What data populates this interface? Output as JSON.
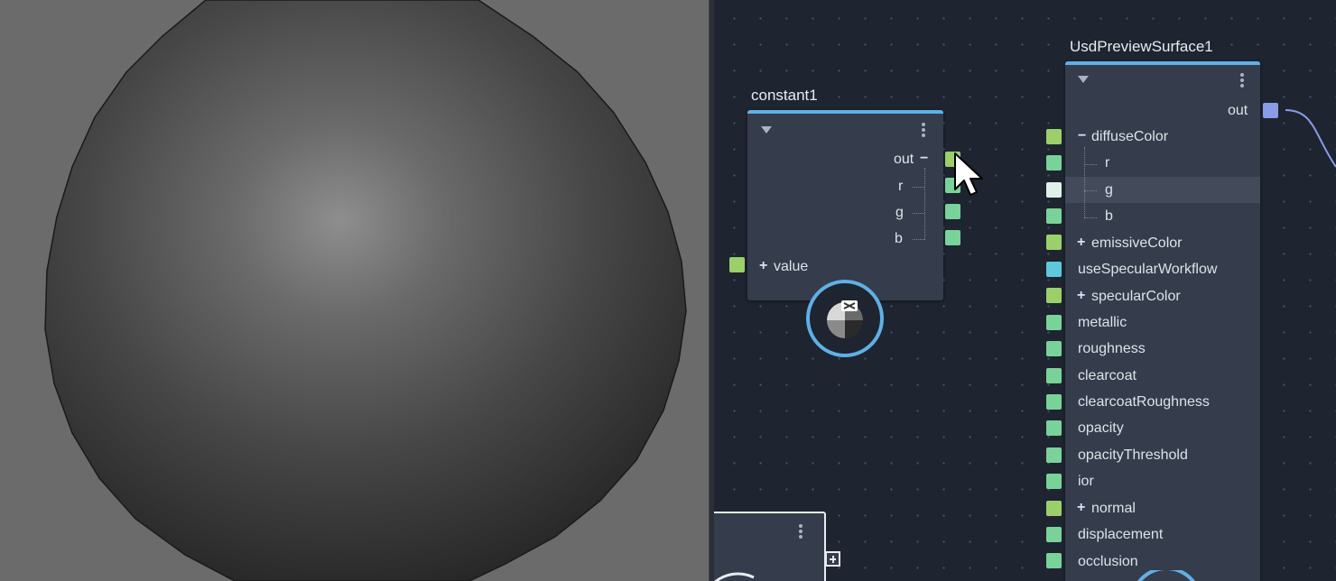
{
  "constant_node": {
    "title": "constant1",
    "outputs": [
      {
        "label": "out",
        "sign": "−"
      },
      {
        "label": "r"
      },
      {
        "label": "g"
      },
      {
        "label": "b"
      }
    ],
    "inputs": [
      {
        "label": "value",
        "sign": "+"
      }
    ]
  },
  "surface_node": {
    "title": "UsdPreviewSurface1",
    "output_label": "out",
    "params": [
      {
        "label": "diffuseColor",
        "sign": "−",
        "port": "green"
      },
      {
        "label": "r",
        "child": true,
        "port": "mint"
      },
      {
        "label": "g",
        "child": true,
        "port": "pale",
        "highlighted": true
      },
      {
        "label": "b",
        "child": true,
        "port": "mint"
      },
      {
        "label": "emissiveColor",
        "sign": "+",
        "port": "green"
      },
      {
        "label": "useSpecularWorkflow",
        "port": "cyan"
      },
      {
        "label": "specularColor",
        "sign": "+",
        "port": "green"
      },
      {
        "label": "metallic",
        "port": "mint"
      },
      {
        "label": "roughness",
        "port": "mint"
      },
      {
        "label": "clearcoat",
        "port": "mint"
      },
      {
        "label": "clearcoatRoughness",
        "port": "mint"
      },
      {
        "label": "opacity",
        "port": "mint"
      },
      {
        "label": "opacityThreshold",
        "port": "mint"
      },
      {
        "label": "ior",
        "port": "mint"
      },
      {
        "label": "normal",
        "sign": "+",
        "port": "green"
      },
      {
        "label": "displacement",
        "port": "mint"
      },
      {
        "label": "occlusion",
        "port": "mint"
      }
    ]
  },
  "colors": {
    "accent": "#5fb0e6",
    "port_green": "#9ccf6a",
    "port_mint": "#79d29a",
    "port_cyan": "#5fc8dc",
    "port_output": "#8a9be8",
    "graph_bg": "#1e2430",
    "node_bg": "#353c4b",
    "viewport_bg": "#6b6b6b"
  },
  "icons": [
    "collapse-triangle-icon",
    "kebab-menu-icon",
    "swatch-preview-icon",
    "plus-icon",
    "mouse-cursor-icon"
  ]
}
